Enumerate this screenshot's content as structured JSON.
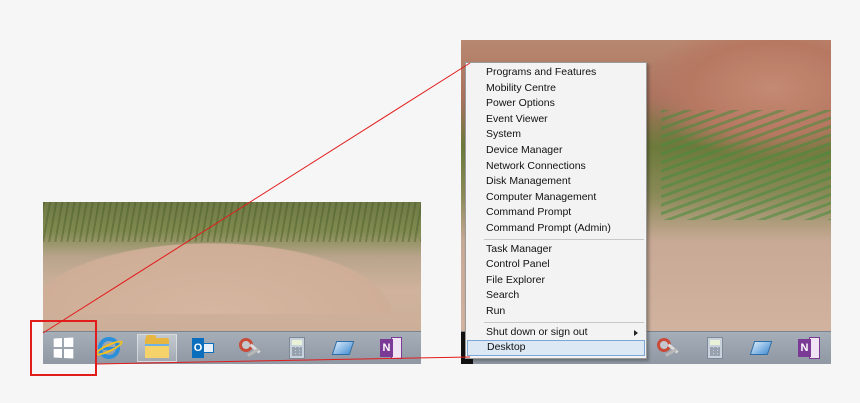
{
  "context_menu": {
    "group1": [
      "Programs and Features",
      "Mobility Centre",
      "Power Options",
      "Event Viewer",
      "System",
      "Device Manager",
      "Network Connections",
      "Disk Management",
      "Computer Management",
      "Command Prompt",
      "Command Prompt (Admin)"
    ],
    "group2": [
      "Task Manager",
      "Control Panel",
      "File Explorer",
      "Search",
      "Run"
    ],
    "group3": [
      "Shut down or sign out",
      "Desktop"
    ],
    "selected_item": "Desktop"
  },
  "taskbar": {
    "icons": [
      "start-icon",
      "internet-explorer-icon",
      "file-explorer-icon",
      "outlook-icon",
      "snipping-tool-icon",
      "calculator-icon",
      "journal-icon",
      "onenote-icon"
    ],
    "outlook_letter": "O",
    "onenote_letter": "N"
  },
  "colors": {
    "highlight_red": "#e21b1b",
    "selection_blue": "#dde8f5",
    "taskbar": "#9aa2ad"
  }
}
